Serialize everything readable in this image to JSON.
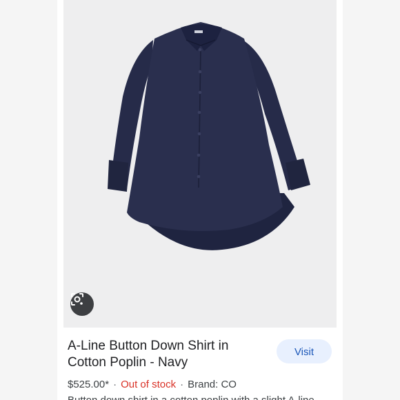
{
  "product": {
    "title_line1": "A-Line Button Down Shirt in",
    "title_line2": "Cotton Poplin - Navy",
    "price": "$525.00*",
    "stock_status": "Out of stock",
    "brand": "Brand: CO",
    "description": "Button down shirt in a cotton poplin with a slight A-line",
    "separator": "·",
    "image_icon": "shirt-illustration",
    "garment_color": "#272c4a"
  },
  "actions": {
    "visit_label": "Visit",
    "lens_icon": "google-lens-icon"
  },
  "colors": {
    "accent": "#1a56b8",
    "stock_alert": "#d93025",
    "visit_bg": "#e8f0fe"
  }
}
